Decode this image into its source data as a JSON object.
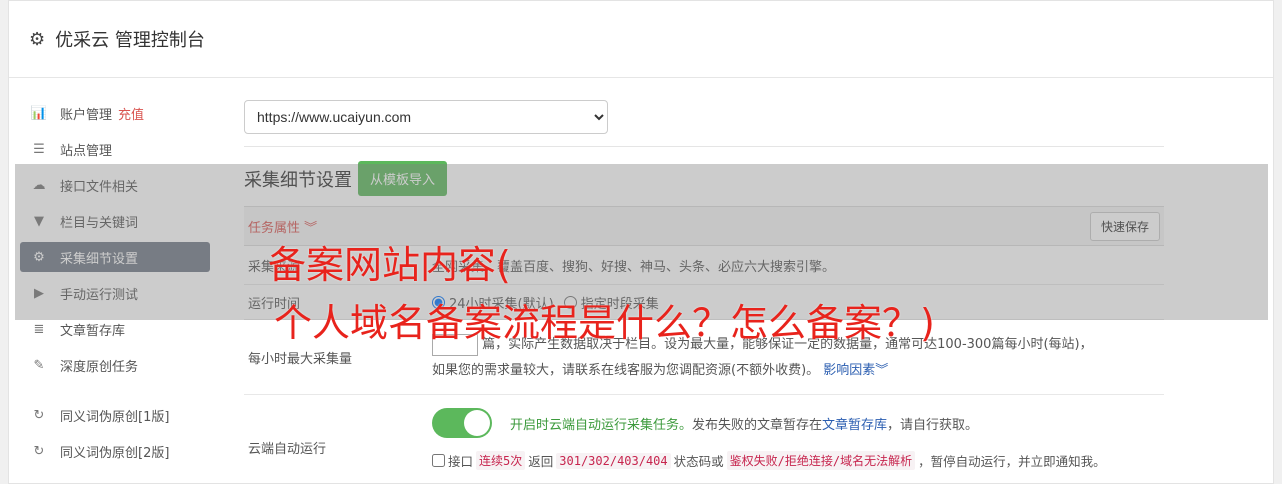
{
  "app": {
    "title": "优采云 管理控制台",
    "icon": "gear-icon"
  },
  "sidebar": {
    "items": [
      {
        "label": "账户管理",
        "badge": "充值",
        "icon": "bar-chart-icon"
      },
      {
        "label": "站点管理",
        "icon": "server-icon"
      },
      {
        "label": "接口文件相关",
        "icon": "cloud-upload-icon"
      },
      {
        "label": "栏目与关键词",
        "icon": "filter-icon"
      },
      {
        "label": "采集细节设置",
        "icon": "gears-icon",
        "active": true
      },
      {
        "label": "手动运行测试",
        "icon": "play-circle-icon"
      },
      {
        "label": "文章暂存库",
        "icon": "database-icon"
      },
      {
        "label": "深度原创任务",
        "icon": "edit-icon"
      },
      {
        "label": "同义词伪原创[1版]",
        "icon": "refresh-icon"
      },
      {
        "label": "同义词伪原创[2版]",
        "icon": "refresh-icon"
      }
    ]
  },
  "main": {
    "site_select": {
      "value": "https://www.ucaiyun.com"
    },
    "section_title": "采集细节设置",
    "import_button": "从模板导入",
    "task_props": "任务属性 ︾",
    "quick_save": "快速保存",
    "rows": {
      "sources": {
        "label": "采集来源",
        "text": "全网采集，覆盖百度、搜狗、好搜、神马、头条、必应六大搜索引擎。"
      },
      "runtime": {
        "label": "运行时间",
        "opt1": "24小时采集(默认)",
        "opt2": "指定时段采集"
      },
      "max_per_hour": {
        "label": "每小时最大采集量",
        "line1": "篇，实际产生数据取决于栏目。设为最大量，能够保证一定的数据量，通常可达100-300篇每小时(每站)，",
        "line2": "如果您的需求量较大，请联系在线客服为您调配资源(不额外收费)。",
        "link": "影响因素︾"
      },
      "cloud_run": {
        "label": "云端自动运行",
        "green": "开启时云端自动运行采集任务。",
        "text1": "发布失败的文章暂存在",
        "link": "文章暂存库",
        "text2": "，请自行获取。",
        "l2_a": "接口",
        "c1": "连续5次",
        "l2_b": "返回",
        "c2": "301/302/403/404",
        "l2_c": "状态码或",
        "c3": "鉴权失败/拒绝连接/域名无法解析",
        "l2_d": "，暂停自动运行，并立即通知我。"
      }
    }
  },
  "overlay": {
    "line1": "备案网站内容(",
    "line2": "个人域名备案流程是什么？怎么备案？)"
  },
  "colors": {
    "accent_green": "#5cb85c",
    "active_bg": "#727b87",
    "headline": "#e8231c",
    "link": "#2a5db0"
  }
}
